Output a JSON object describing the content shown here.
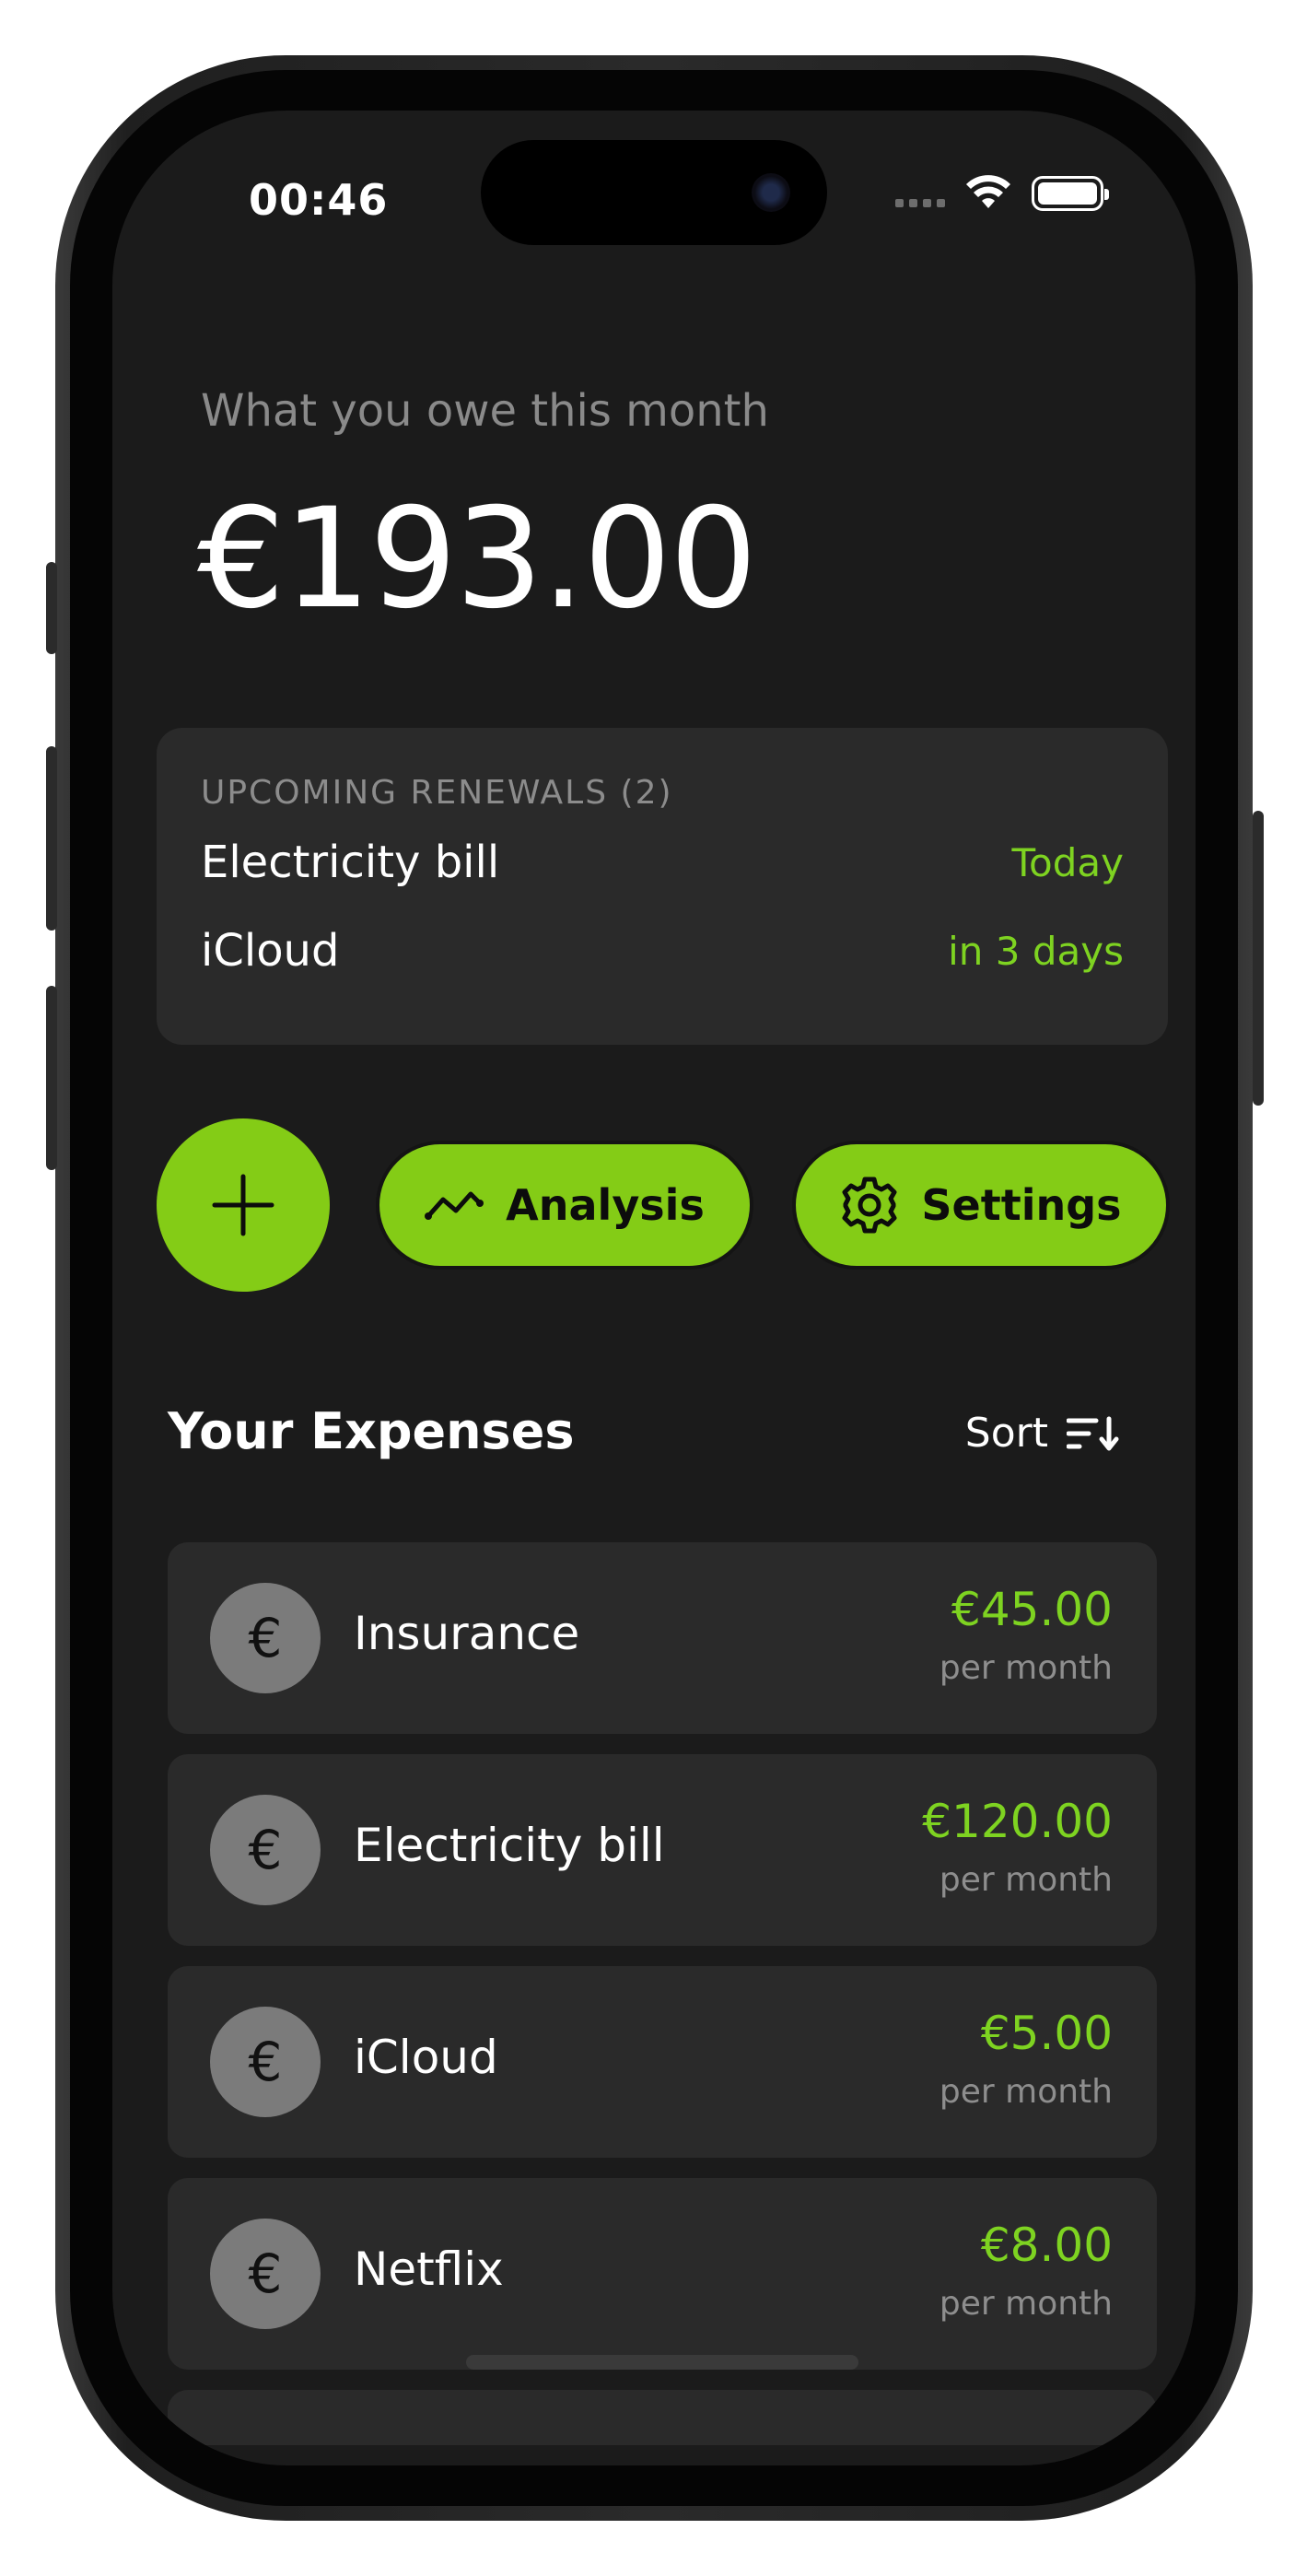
{
  "status_bar": {
    "time": "00:46",
    "wifi_icon": "wifi-icon",
    "battery_icon": "battery-icon"
  },
  "summary": {
    "label": "What you owe this month",
    "amount": "€193.00"
  },
  "renewals": {
    "header": "UPCOMING RENEWALS (2)",
    "items": [
      {
        "name": "Electricity bill",
        "when": "Today"
      },
      {
        "name": "iCloud",
        "when": "in 3 days"
      }
    ]
  },
  "actions": {
    "add_icon": "plus-icon",
    "analysis_label": "Analysis",
    "analysis_icon": "trend-line-icon",
    "settings_label": "Settings",
    "settings_icon": "gear-icon"
  },
  "expenses": {
    "title": "Your Expenses",
    "sort_label": "Sort",
    "sort_icon": "sort-icon",
    "items": [
      {
        "icon": "€",
        "name": "Insurance",
        "amount": "€45.00",
        "period": "per month"
      },
      {
        "icon": "€",
        "name": "Electricity bill",
        "amount": "€120.00",
        "period": "per month"
      },
      {
        "icon": "€",
        "name": "iCloud",
        "amount": "€5.00",
        "period": "per month"
      },
      {
        "icon": "€",
        "name": "Netflix",
        "amount": "€8.00",
        "period": "per month"
      }
    ]
  },
  "colors": {
    "accent": "#84cc16",
    "accent_text": "#7ed321",
    "background": "#1b1b1b",
    "card": "#2a2a2a"
  }
}
